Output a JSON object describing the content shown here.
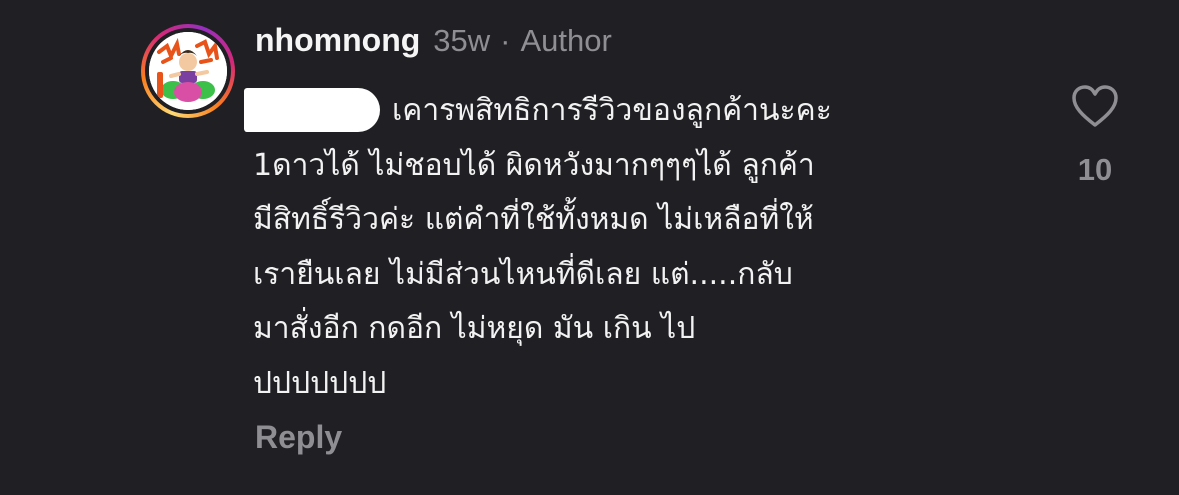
{
  "comment": {
    "username": "nhomnong",
    "age": "35w",
    "separator": "·",
    "role_badge": "Author",
    "text_lines": [
      "เคารพสิทธิการรีวิวของลูกค้านะคะ",
      "1ดาวได้ ไม่ชอบได้ ผิดหวังมากๆๆๆได้ ลูกค้า",
      "มีสิทธิ์รีวิวค่ะ แต่คำที่ใช้ทั้งหมด ไม่เหลือที่ให้",
      "เรายืนเลย ไม่มีส่วนไหนที่ดีเลย แต่.....กลับ",
      "มาสั่งอีก กดอีก ไม่หยุด มัน เกิน ไป",
      "ปปปปปปป"
    ],
    "reply_label": "Reply",
    "like_count": "10",
    "like_icon": "heart-outline-icon",
    "avatar_icon": "cartoon-avatar"
  },
  "colors": {
    "background": "#1f1f24",
    "primary_text": "#f2f2f2",
    "secondary_text": "#8e8e93",
    "avatar_ring": [
      "#feda75",
      "#fa7e1e",
      "#d62976",
      "#962fbf"
    ]
  }
}
